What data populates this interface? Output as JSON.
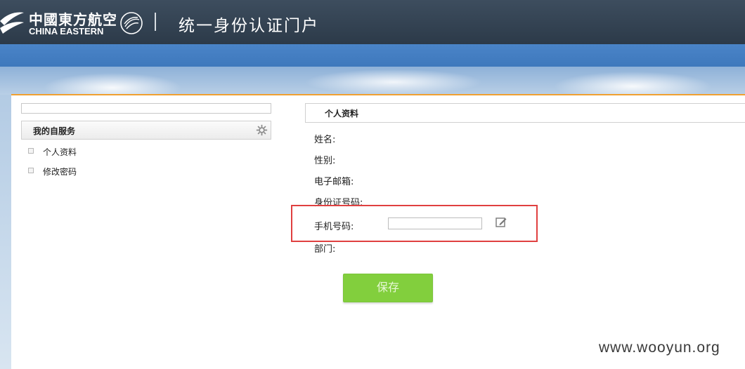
{
  "header": {
    "logo_cn": "中國東方航空",
    "logo_en": "CHINA EASTERN",
    "separator": "|",
    "portal_title": "统一身份认证门户"
  },
  "sidebar": {
    "search_placeholder": "",
    "section_title": "我的自服务",
    "items": [
      {
        "label": "个人资料"
      },
      {
        "label": "修改密码"
      }
    ]
  },
  "panel": {
    "title": "个人资料",
    "fields": {
      "name_label": "姓名:",
      "gender_label": "性别:",
      "email_label": "电子邮箱:",
      "id_label": "身份证号码:",
      "phone_label": "手机号码:",
      "phone_value": "",
      "department_label": "部门:"
    },
    "save_label": "保存"
  },
  "colors": {
    "header_bg": "#2c3a49",
    "blue_band": "#4a84c8",
    "accent_orange": "#f0a030",
    "save_button": "#82cf3d",
    "highlight_red": "#e04040"
  },
  "watermark": "www.wooyun.org"
}
